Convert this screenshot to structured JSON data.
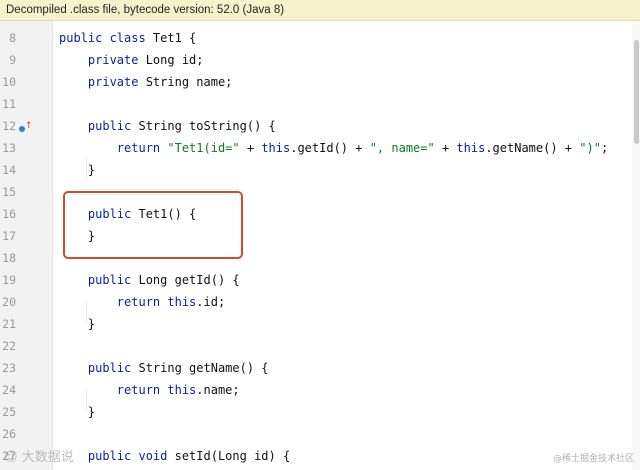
{
  "banner": {
    "text": "Decompiled .class file, bytecode version: 52.0 (Java 8)"
  },
  "editor": {
    "lines": [
      {
        "num": "8",
        "segments": [
          {
            "t": "public class ",
            "k": "kw"
          },
          {
            "t": "Tet1 {",
            "k": "plain"
          }
        ]
      },
      {
        "num": "9",
        "segments": [
          {
            "t": "    private ",
            "k": "kw"
          },
          {
            "t": "Long id;",
            "k": "plain"
          }
        ]
      },
      {
        "num": "10",
        "segments": [
          {
            "t": "    private ",
            "k": "kw"
          },
          {
            "t": "String name;",
            "k": "plain"
          }
        ]
      },
      {
        "num": "11",
        "segments": []
      },
      {
        "num": "12",
        "segments": [
          {
            "t": "    public ",
            "k": "kw"
          },
          {
            "t": "String toString() {",
            "k": "plain"
          }
        ]
      },
      {
        "num": "13",
        "segments": [
          {
            "t": "        return ",
            "k": "kw"
          },
          {
            "t": "\"Tet1(id=\"",
            "k": "str"
          },
          {
            "t": " + ",
            "k": "plain"
          },
          {
            "t": "this",
            "k": "kw"
          },
          {
            "t": ".getId() + ",
            "k": "plain"
          },
          {
            "t": "\", name=\"",
            "k": "str"
          },
          {
            "t": " + ",
            "k": "plain"
          },
          {
            "t": "this",
            "k": "kw"
          },
          {
            "t": ".getName() + ",
            "k": "plain"
          },
          {
            "t": "\")\"",
            "k": "str"
          },
          {
            "t": ";",
            "k": "plain"
          }
        ]
      },
      {
        "num": "14",
        "segments": [
          {
            "t": "    }",
            "k": "plain"
          }
        ]
      },
      {
        "num": "15",
        "segments": []
      },
      {
        "num": "16",
        "segments": [
          {
            "t": "    public ",
            "k": "kw"
          },
          {
            "t": "Tet1() {",
            "k": "plain"
          }
        ]
      },
      {
        "num": "17",
        "segments": [
          {
            "t": "    }",
            "k": "plain"
          }
        ]
      },
      {
        "num": "18",
        "segments": []
      },
      {
        "num": "19",
        "segments": [
          {
            "t": "    public ",
            "k": "kw"
          },
          {
            "t": "Long getId() {",
            "k": "plain"
          }
        ]
      },
      {
        "num": "20",
        "segments": [
          {
            "t": "        return ",
            "k": "kw"
          },
          {
            "t": "this",
            "k": "kw"
          },
          {
            "t": ".id;",
            "k": "plain"
          }
        ]
      },
      {
        "num": "21",
        "segments": [
          {
            "t": "    }",
            "k": "plain"
          }
        ]
      },
      {
        "num": "22",
        "segments": []
      },
      {
        "num": "23",
        "segments": [
          {
            "t": "    public ",
            "k": "kw"
          },
          {
            "t": "String getName() {",
            "k": "plain"
          }
        ]
      },
      {
        "num": "24",
        "segments": [
          {
            "t": "        return ",
            "k": "kw"
          },
          {
            "t": "this",
            "k": "kw"
          },
          {
            "t": ".name;",
            "k": "plain"
          }
        ]
      },
      {
        "num": "25",
        "segments": [
          {
            "t": "    }",
            "k": "plain"
          }
        ]
      },
      {
        "num": "26",
        "segments": []
      },
      {
        "num": "27",
        "segments": [
          {
            "t": "    public ",
            "k": "kw"
          },
          {
            "t": "void ",
            "k": "kw"
          },
          {
            "t": "setId(Long id) {",
            "k": "plain"
          }
        ]
      }
    ],
    "override_marker_icon": "override-method-icon"
  },
  "colors": {
    "keyword": "#0b1f9e",
    "string": "#0a7d2c",
    "highlight_box": "#cf4b33",
    "banner_bg": "#f7f1cc"
  },
  "watermarks": {
    "left": "大数据说",
    "right": "@稀土掘金技术社区"
  }
}
